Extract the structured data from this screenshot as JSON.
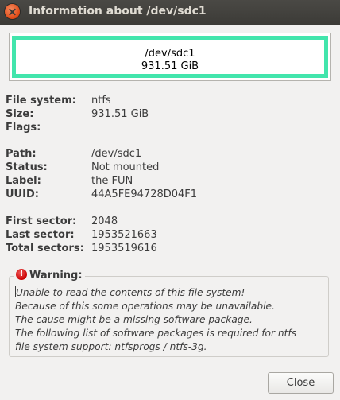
{
  "window": {
    "title": "Information about /dev/sdc1"
  },
  "partition_graphic": {
    "path": "/dev/sdc1",
    "size": "931.51 GiB",
    "color": "#42e5ac"
  },
  "fs_info": [
    {
      "label": "File system:",
      "value": "ntfs"
    },
    {
      "label": "Size:",
      "value": "931.51 GiB"
    },
    {
      "label": "Flags:",
      "value": ""
    }
  ],
  "path_info": [
    {
      "label": "Path:",
      "value": "/dev/sdc1"
    },
    {
      "label": "Status:",
      "value": "Not mounted"
    },
    {
      "label": "Label:",
      "value": "the FUN"
    },
    {
      "label": "UUID:",
      "value": "44A5FE94728D04F1"
    }
  ],
  "sector_info": [
    {
      "label": "First sector:",
      "value": "2048"
    },
    {
      "label": "Last sector:",
      "value": "1953521663"
    },
    {
      "label": "Total sectors:",
      "value": "1953519616"
    }
  ],
  "warning": {
    "icon": "error-icon",
    "heading": "Warning:",
    "lines": [
      "Unable to read the contents of this file system!",
      "Because of this some operations may be unavailable.",
      "The cause might be a missing software package.",
      "The following list of software packages is required for ntfs",
      "file system support:  ntfsprogs / ntfs-3g."
    ]
  },
  "buttons": {
    "close_label": "Close"
  }
}
